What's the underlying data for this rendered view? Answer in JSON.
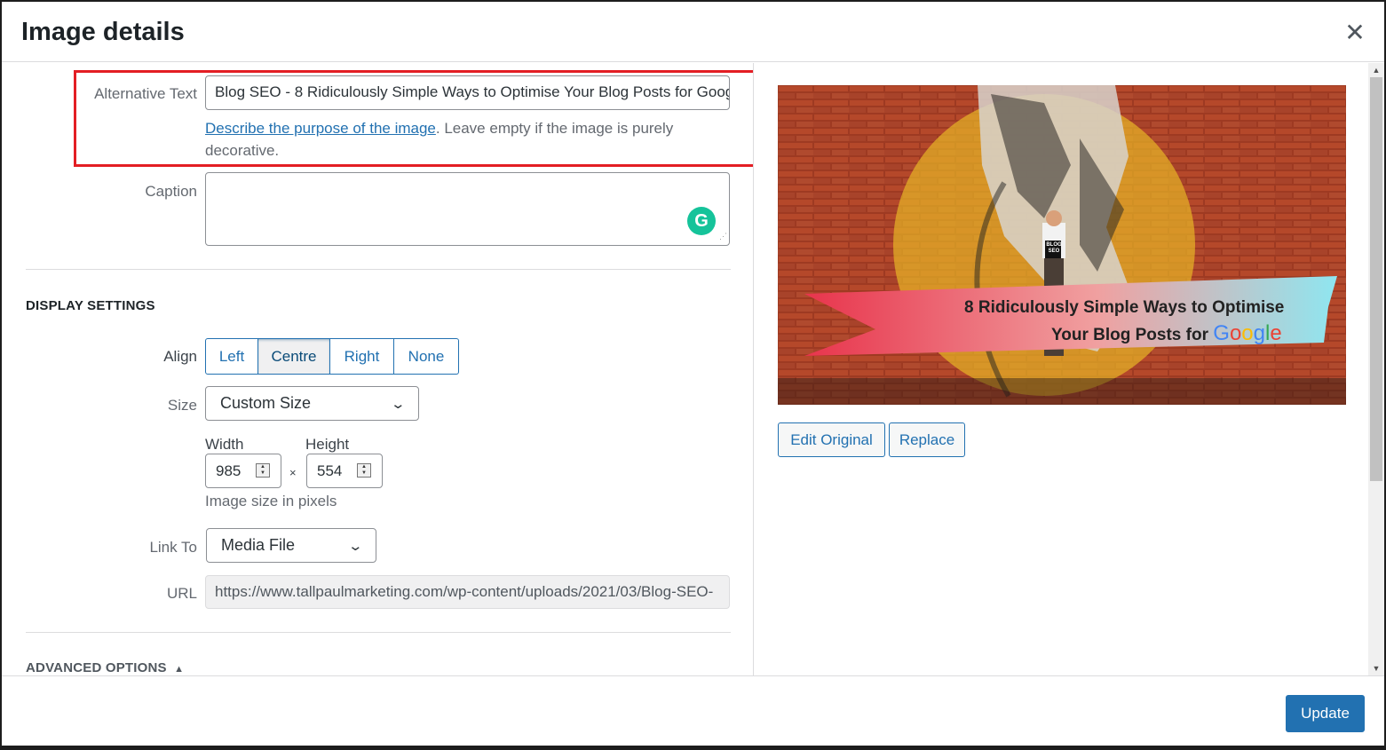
{
  "modal": {
    "title": "Image details",
    "close_icon": "close-icon"
  },
  "alt_text": {
    "label": "Alternative Text",
    "value": "Blog SEO - 8 Ridiculously Simple Ways to Optimise Your Blog Posts for Goog",
    "help_link": "Describe the purpose of the image",
    "help_text": ". Leave empty if the image is purely decorative."
  },
  "caption": {
    "label": "Caption",
    "value": ""
  },
  "display_settings": {
    "title": "DISPLAY SETTINGS",
    "align": {
      "label": "Align",
      "options": [
        "Left",
        "Centre",
        "Right",
        "None"
      ],
      "selected": "Centre"
    },
    "size": {
      "label": "Size",
      "value": "Custom Size"
    },
    "width": {
      "label": "Width",
      "value": "985"
    },
    "height": {
      "label": "Height",
      "value": "554"
    },
    "times": "×",
    "size_help": "Image size in pixels",
    "link_to": {
      "label": "Link To",
      "value": "Media File"
    },
    "url": {
      "label": "URL",
      "value": "https://www.tallpaulmarketing.com/wp-content/uploads/2021/03/Blog-SEO-"
    }
  },
  "advanced": {
    "title": "ADVANCED OPTIONS",
    "arrow": "▲"
  },
  "preview": {
    "headline_line1": "8 Ridiculously Simple Ways to Optimise",
    "headline_line2": "Your Blog Posts for",
    "google": [
      "G",
      "o",
      "o",
      "g",
      "l",
      "e"
    ],
    "google_colors": [
      "#4285F4",
      "#EA4335",
      "#FBBC05",
      "#4285F4",
      "#34A853",
      "#EA4335"
    ],
    "sign_text": "BLOG SEO",
    "edit_original": "Edit Original",
    "replace": "Replace"
  },
  "footer": {
    "update": "Update"
  },
  "colors": {
    "accent": "#2271b1",
    "highlight": "#e31e24"
  }
}
